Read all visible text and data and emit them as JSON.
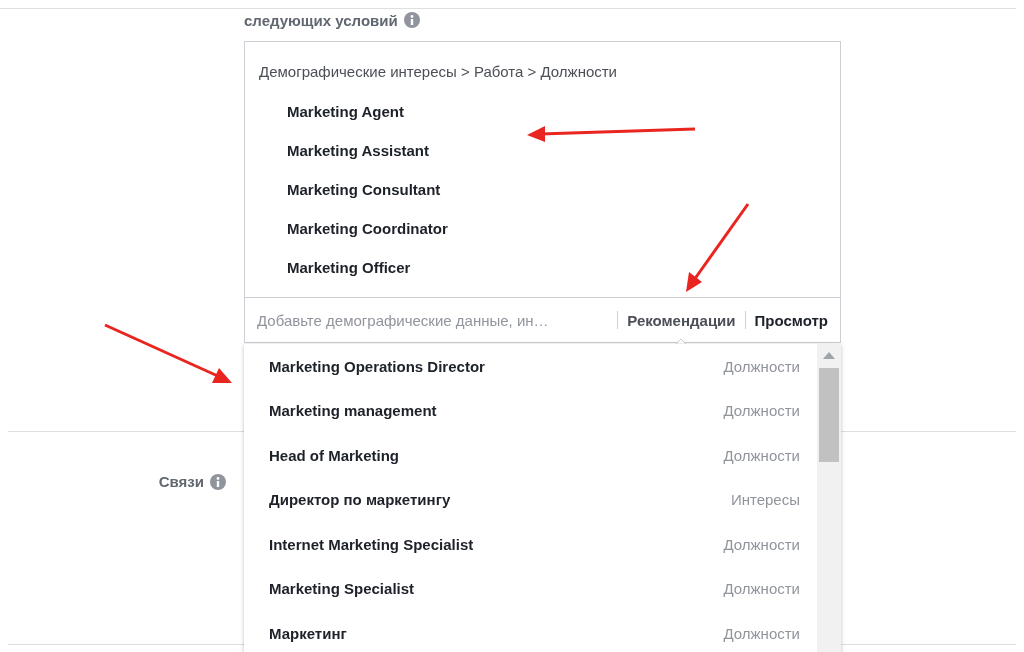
{
  "header": {
    "title": "следующих условий"
  },
  "targeting": {
    "breadcrumb": "Демографические интересы > Работа > Должности",
    "items": [
      "Marketing Agent",
      "Marketing Assistant",
      "Marketing Consultant",
      "Marketing Coordinator",
      "Marketing Officer"
    ]
  },
  "search": {
    "placeholder": "Добавьте демографические данные, ин…"
  },
  "tabs": [
    {
      "label": "Рекомендации",
      "selected": true
    },
    {
      "label": "Просмотр",
      "selected": false
    }
  ],
  "suggestions": [
    {
      "name": "Marketing Operations Director",
      "category": "Должности"
    },
    {
      "name": "Marketing management",
      "category": "Должности"
    },
    {
      "name": "Head of Marketing",
      "category": "Должности"
    },
    {
      "name": "Директор по маркетингу",
      "category": "Интересы"
    },
    {
      "name": "Internet Marketing Specialist",
      "category": "Должности"
    },
    {
      "name": "Marketing Specialist",
      "category": "Должности"
    },
    {
      "name": "Маркетинг",
      "category": "Должности"
    }
  ],
  "connections": {
    "label": "Связи"
  }
}
